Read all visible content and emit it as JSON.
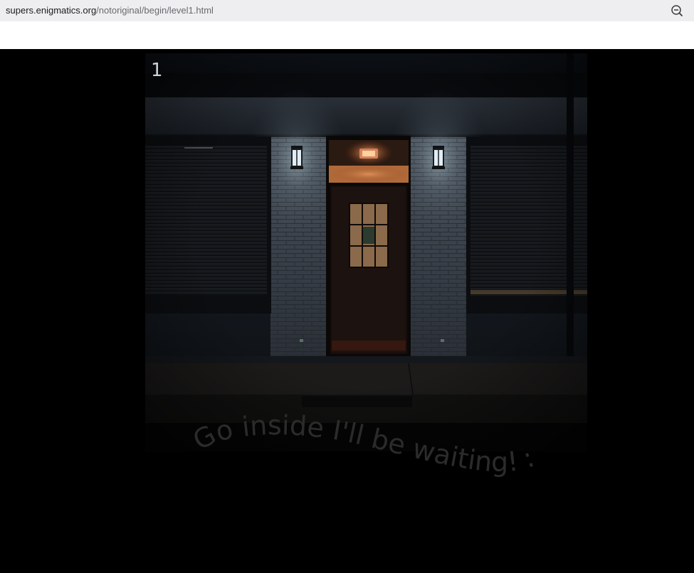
{
  "browser": {
    "url_domain": "supers.enigmatics.org",
    "url_path": "/notoriginal/begin/level1.html",
    "zoom_icon": "zoom-out-icon"
  },
  "level": {
    "number": "1",
    "caption": "Go inside I'll be waiting! :)"
  }
}
